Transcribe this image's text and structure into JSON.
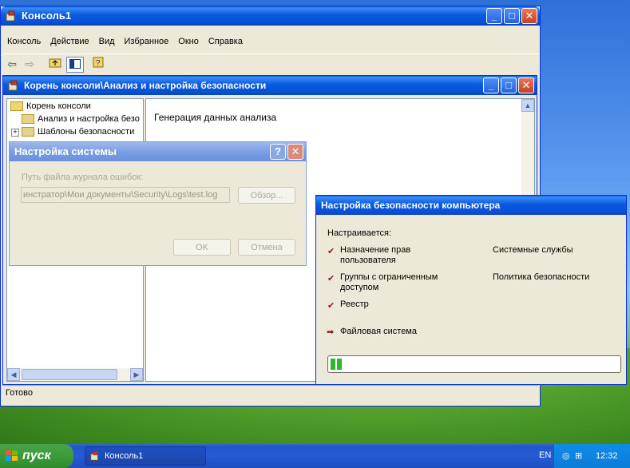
{
  "main_window": {
    "title": "Консоль1",
    "menu": [
      "Консоль",
      "Действие",
      "Вид",
      "Избранное",
      "Окно",
      "Справка"
    ],
    "status": "Готово"
  },
  "child_window": {
    "title": "Корень консоли\\Анализ и настройка безопасности",
    "tree": {
      "root": "Корень консоли",
      "item1": "Анализ и настройка безо",
      "item2": "Шаблоны безопасности"
    },
    "right_text": "Генерация данных анализа"
  },
  "system_dialog": {
    "title": "Настройка системы",
    "help_label": "?",
    "log_label": "Путь файла журнала ошибок:",
    "log_value": "инстратор\\Мои документы\\Security\\Logs\\test.log",
    "browse": "Обзор...",
    "ok": "OK",
    "cancel": "Отмена"
  },
  "progress_dialog": {
    "title": "Настройка безопасности компьютера",
    "configuring": "Настраивается:",
    "items": {
      "left1": "Назначение прав пользователя",
      "left2": "Группы с ограниченным доступом",
      "left3": "Реестр",
      "left4": "Файловая система",
      "right1": "Системные службы",
      "right2": "Политика безопасности"
    },
    "progress": 0.04
  },
  "taskbar": {
    "start": "пуск",
    "task": "Консоль1",
    "lang": "EN",
    "time": "12:32"
  },
  "colors": {
    "title_blue": "#0a5ae0",
    "check_red": "#8b1a1a",
    "progress_green": "#2fb52f"
  }
}
